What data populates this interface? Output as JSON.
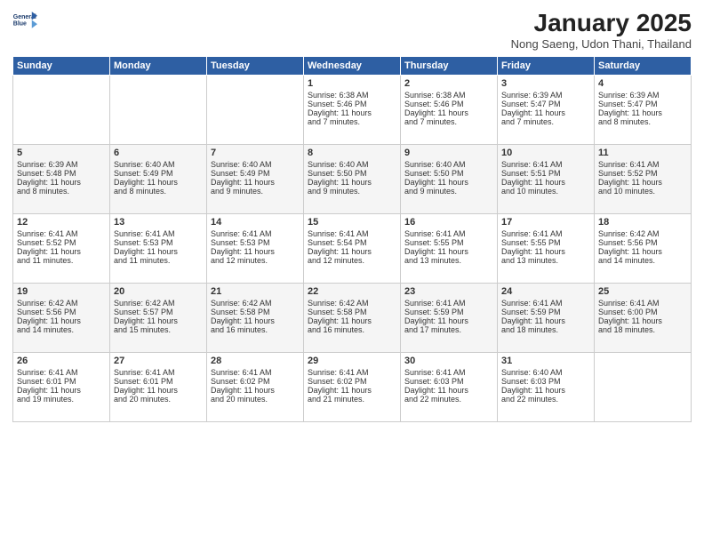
{
  "header": {
    "logo_line1": "General",
    "logo_line2": "Blue",
    "title": "January 2025",
    "subtitle": "Nong Saeng, Udon Thani, Thailand"
  },
  "weekdays": [
    "Sunday",
    "Monday",
    "Tuesday",
    "Wednesday",
    "Thursday",
    "Friday",
    "Saturday"
  ],
  "weeks": [
    [
      {
        "day": "",
        "info": ""
      },
      {
        "day": "",
        "info": ""
      },
      {
        "day": "",
        "info": ""
      },
      {
        "day": "1",
        "info": "Sunrise: 6:38 AM\nSunset: 5:46 PM\nDaylight: 11 hours\nand 7 minutes."
      },
      {
        "day": "2",
        "info": "Sunrise: 6:38 AM\nSunset: 5:46 PM\nDaylight: 11 hours\nand 7 minutes."
      },
      {
        "day": "3",
        "info": "Sunrise: 6:39 AM\nSunset: 5:47 PM\nDaylight: 11 hours\nand 7 minutes."
      },
      {
        "day": "4",
        "info": "Sunrise: 6:39 AM\nSunset: 5:47 PM\nDaylight: 11 hours\nand 8 minutes."
      }
    ],
    [
      {
        "day": "5",
        "info": "Sunrise: 6:39 AM\nSunset: 5:48 PM\nDaylight: 11 hours\nand 8 minutes."
      },
      {
        "day": "6",
        "info": "Sunrise: 6:40 AM\nSunset: 5:49 PM\nDaylight: 11 hours\nand 8 minutes."
      },
      {
        "day": "7",
        "info": "Sunrise: 6:40 AM\nSunset: 5:49 PM\nDaylight: 11 hours\nand 9 minutes."
      },
      {
        "day": "8",
        "info": "Sunrise: 6:40 AM\nSunset: 5:50 PM\nDaylight: 11 hours\nand 9 minutes."
      },
      {
        "day": "9",
        "info": "Sunrise: 6:40 AM\nSunset: 5:50 PM\nDaylight: 11 hours\nand 9 minutes."
      },
      {
        "day": "10",
        "info": "Sunrise: 6:41 AM\nSunset: 5:51 PM\nDaylight: 11 hours\nand 10 minutes."
      },
      {
        "day": "11",
        "info": "Sunrise: 6:41 AM\nSunset: 5:52 PM\nDaylight: 11 hours\nand 10 minutes."
      }
    ],
    [
      {
        "day": "12",
        "info": "Sunrise: 6:41 AM\nSunset: 5:52 PM\nDaylight: 11 hours\nand 11 minutes."
      },
      {
        "day": "13",
        "info": "Sunrise: 6:41 AM\nSunset: 5:53 PM\nDaylight: 11 hours\nand 11 minutes."
      },
      {
        "day": "14",
        "info": "Sunrise: 6:41 AM\nSunset: 5:53 PM\nDaylight: 11 hours\nand 12 minutes."
      },
      {
        "day": "15",
        "info": "Sunrise: 6:41 AM\nSunset: 5:54 PM\nDaylight: 11 hours\nand 12 minutes."
      },
      {
        "day": "16",
        "info": "Sunrise: 6:41 AM\nSunset: 5:55 PM\nDaylight: 11 hours\nand 13 minutes."
      },
      {
        "day": "17",
        "info": "Sunrise: 6:41 AM\nSunset: 5:55 PM\nDaylight: 11 hours\nand 13 minutes."
      },
      {
        "day": "18",
        "info": "Sunrise: 6:42 AM\nSunset: 5:56 PM\nDaylight: 11 hours\nand 14 minutes."
      }
    ],
    [
      {
        "day": "19",
        "info": "Sunrise: 6:42 AM\nSunset: 5:56 PM\nDaylight: 11 hours\nand 14 minutes."
      },
      {
        "day": "20",
        "info": "Sunrise: 6:42 AM\nSunset: 5:57 PM\nDaylight: 11 hours\nand 15 minutes."
      },
      {
        "day": "21",
        "info": "Sunrise: 6:42 AM\nSunset: 5:58 PM\nDaylight: 11 hours\nand 16 minutes."
      },
      {
        "day": "22",
        "info": "Sunrise: 6:42 AM\nSunset: 5:58 PM\nDaylight: 11 hours\nand 16 minutes."
      },
      {
        "day": "23",
        "info": "Sunrise: 6:41 AM\nSunset: 5:59 PM\nDaylight: 11 hours\nand 17 minutes."
      },
      {
        "day": "24",
        "info": "Sunrise: 6:41 AM\nSunset: 5:59 PM\nDaylight: 11 hours\nand 18 minutes."
      },
      {
        "day": "25",
        "info": "Sunrise: 6:41 AM\nSunset: 6:00 PM\nDaylight: 11 hours\nand 18 minutes."
      }
    ],
    [
      {
        "day": "26",
        "info": "Sunrise: 6:41 AM\nSunset: 6:01 PM\nDaylight: 11 hours\nand 19 minutes."
      },
      {
        "day": "27",
        "info": "Sunrise: 6:41 AM\nSunset: 6:01 PM\nDaylight: 11 hours\nand 20 minutes."
      },
      {
        "day": "28",
        "info": "Sunrise: 6:41 AM\nSunset: 6:02 PM\nDaylight: 11 hours\nand 20 minutes."
      },
      {
        "day": "29",
        "info": "Sunrise: 6:41 AM\nSunset: 6:02 PM\nDaylight: 11 hours\nand 21 minutes."
      },
      {
        "day": "30",
        "info": "Sunrise: 6:41 AM\nSunset: 6:03 PM\nDaylight: 11 hours\nand 22 minutes."
      },
      {
        "day": "31",
        "info": "Sunrise: 6:40 AM\nSunset: 6:03 PM\nDaylight: 11 hours\nand 22 minutes."
      },
      {
        "day": "",
        "info": ""
      }
    ]
  ]
}
